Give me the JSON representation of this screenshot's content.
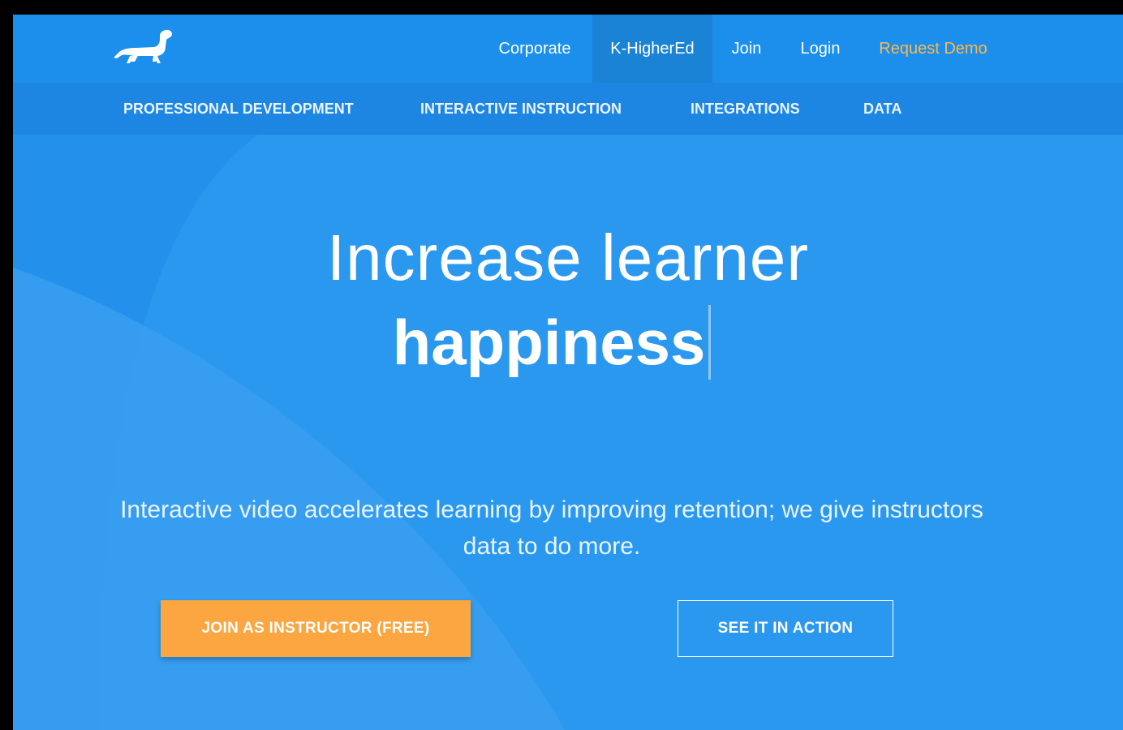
{
  "brand": {
    "logo_icon": "dachshund-logo-icon"
  },
  "top_nav": {
    "items": [
      {
        "label": "Corporate",
        "active": false
      },
      {
        "label": "K-HigherEd",
        "active": true
      },
      {
        "label": "Join",
        "active": false
      },
      {
        "label": "Login",
        "active": false
      },
      {
        "label": "Request Demo",
        "active": false,
        "color": "#ffb84a"
      }
    ]
  },
  "sub_nav": {
    "items": [
      {
        "label": "PROFESSIONAL DEVELOPMENT"
      },
      {
        "label": "INTERACTIVE INSTRUCTION"
      },
      {
        "label": "INTEGRATIONS"
      },
      {
        "label": "DATA"
      }
    ]
  },
  "hero": {
    "headline_line1": "Increase learner",
    "headline_line2": "happiness",
    "subtitle": "Interactive video accelerates learning by improving retention; we give instructors data to do more."
  },
  "cta": {
    "primary_label": "JOIN AS INSTRUCTOR (FREE)",
    "secondary_label": "SEE IT IN ACTION"
  },
  "colors": {
    "background": "#2a98ee",
    "header": "#1b8feb",
    "subnav": "#1c86e2",
    "accent_orange": "#fba640"
  }
}
